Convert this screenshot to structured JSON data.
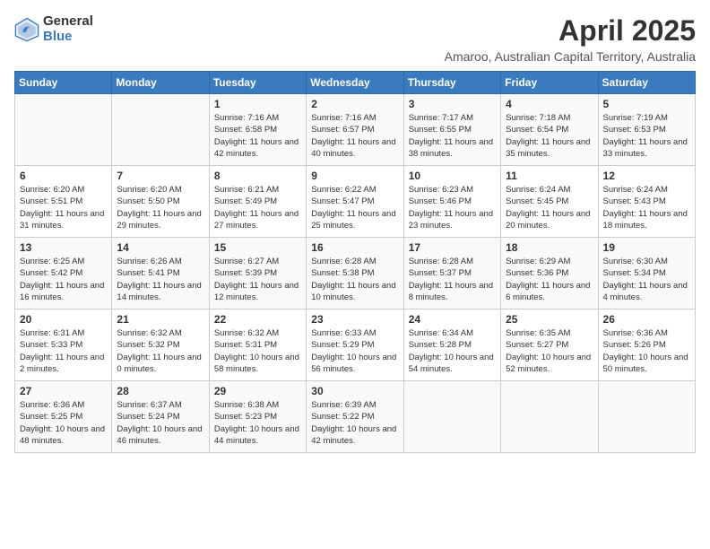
{
  "logo": {
    "general": "General",
    "blue": "Blue"
  },
  "title": "April 2025",
  "subtitle": "Amaroo, Australian Capital Territory, Australia",
  "days_of_week": [
    "Sunday",
    "Monday",
    "Tuesday",
    "Wednesday",
    "Thursday",
    "Friday",
    "Saturday"
  ],
  "weeks": [
    [
      {
        "day": "",
        "info": ""
      },
      {
        "day": "",
        "info": ""
      },
      {
        "day": "1",
        "sunrise": "Sunrise: 7:16 AM",
        "sunset": "Sunset: 6:58 PM",
        "daylight": "Daylight: 11 hours and 42 minutes."
      },
      {
        "day": "2",
        "sunrise": "Sunrise: 7:16 AM",
        "sunset": "Sunset: 6:57 PM",
        "daylight": "Daylight: 11 hours and 40 minutes."
      },
      {
        "day": "3",
        "sunrise": "Sunrise: 7:17 AM",
        "sunset": "Sunset: 6:55 PM",
        "daylight": "Daylight: 11 hours and 38 minutes."
      },
      {
        "day": "4",
        "sunrise": "Sunrise: 7:18 AM",
        "sunset": "Sunset: 6:54 PM",
        "daylight": "Daylight: 11 hours and 35 minutes."
      },
      {
        "day": "5",
        "sunrise": "Sunrise: 7:19 AM",
        "sunset": "Sunset: 6:53 PM",
        "daylight": "Daylight: 11 hours and 33 minutes."
      }
    ],
    [
      {
        "day": "6",
        "sunrise": "Sunrise: 6:20 AM",
        "sunset": "Sunset: 5:51 PM",
        "daylight": "Daylight: 11 hours and 31 minutes."
      },
      {
        "day": "7",
        "sunrise": "Sunrise: 6:20 AM",
        "sunset": "Sunset: 5:50 PM",
        "daylight": "Daylight: 11 hours and 29 minutes."
      },
      {
        "day": "8",
        "sunrise": "Sunrise: 6:21 AM",
        "sunset": "Sunset: 5:49 PM",
        "daylight": "Daylight: 11 hours and 27 minutes."
      },
      {
        "day": "9",
        "sunrise": "Sunrise: 6:22 AM",
        "sunset": "Sunset: 5:47 PM",
        "daylight": "Daylight: 11 hours and 25 minutes."
      },
      {
        "day": "10",
        "sunrise": "Sunrise: 6:23 AM",
        "sunset": "Sunset: 5:46 PM",
        "daylight": "Daylight: 11 hours and 23 minutes."
      },
      {
        "day": "11",
        "sunrise": "Sunrise: 6:24 AM",
        "sunset": "Sunset: 5:45 PM",
        "daylight": "Daylight: 11 hours and 20 minutes."
      },
      {
        "day": "12",
        "sunrise": "Sunrise: 6:24 AM",
        "sunset": "Sunset: 5:43 PM",
        "daylight": "Daylight: 11 hours and 18 minutes."
      }
    ],
    [
      {
        "day": "13",
        "sunrise": "Sunrise: 6:25 AM",
        "sunset": "Sunset: 5:42 PM",
        "daylight": "Daylight: 11 hours and 16 minutes."
      },
      {
        "day": "14",
        "sunrise": "Sunrise: 6:26 AM",
        "sunset": "Sunset: 5:41 PM",
        "daylight": "Daylight: 11 hours and 14 minutes."
      },
      {
        "day": "15",
        "sunrise": "Sunrise: 6:27 AM",
        "sunset": "Sunset: 5:39 PM",
        "daylight": "Daylight: 11 hours and 12 minutes."
      },
      {
        "day": "16",
        "sunrise": "Sunrise: 6:28 AM",
        "sunset": "Sunset: 5:38 PM",
        "daylight": "Daylight: 11 hours and 10 minutes."
      },
      {
        "day": "17",
        "sunrise": "Sunrise: 6:28 AM",
        "sunset": "Sunset: 5:37 PM",
        "daylight": "Daylight: 11 hours and 8 minutes."
      },
      {
        "day": "18",
        "sunrise": "Sunrise: 6:29 AM",
        "sunset": "Sunset: 5:36 PM",
        "daylight": "Daylight: 11 hours and 6 minutes."
      },
      {
        "day": "19",
        "sunrise": "Sunrise: 6:30 AM",
        "sunset": "Sunset: 5:34 PM",
        "daylight": "Daylight: 11 hours and 4 minutes."
      }
    ],
    [
      {
        "day": "20",
        "sunrise": "Sunrise: 6:31 AM",
        "sunset": "Sunset: 5:33 PM",
        "daylight": "Daylight: 11 hours and 2 minutes."
      },
      {
        "day": "21",
        "sunrise": "Sunrise: 6:32 AM",
        "sunset": "Sunset: 5:32 PM",
        "daylight": "Daylight: 11 hours and 0 minutes."
      },
      {
        "day": "22",
        "sunrise": "Sunrise: 6:32 AM",
        "sunset": "Sunset: 5:31 PM",
        "daylight": "Daylight: 10 hours and 58 minutes."
      },
      {
        "day": "23",
        "sunrise": "Sunrise: 6:33 AM",
        "sunset": "Sunset: 5:29 PM",
        "daylight": "Daylight: 10 hours and 56 minutes."
      },
      {
        "day": "24",
        "sunrise": "Sunrise: 6:34 AM",
        "sunset": "Sunset: 5:28 PM",
        "daylight": "Daylight: 10 hours and 54 minutes."
      },
      {
        "day": "25",
        "sunrise": "Sunrise: 6:35 AM",
        "sunset": "Sunset: 5:27 PM",
        "daylight": "Daylight: 10 hours and 52 minutes."
      },
      {
        "day": "26",
        "sunrise": "Sunrise: 6:36 AM",
        "sunset": "Sunset: 5:26 PM",
        "daylight": "Daylight: 10 hours and 50 minutes."
      }
    ],
    [
      {
        "day": "27",
        "sunrise": "Sunrise: 6:36 AM",
        "sunset": "Sunset: 5:25 PM",
        "daylight": "Daylight: 10 hours and 48 minutes."
      },
      {
        "day": "28",
        "sunrise": "Sunrise: 6:37 AM",
        "sunset": "Sunset: 5:24 PM",
        "daylight": "Daylight: 10 hours and 46 minutes."
      },
      {
        "day": "29",
        "sunrise": "Sunrise: 6:38 AM",
        "sunset": "Sunset: 5:23 PM",
        "daylight": "Daylight: 10 hours and 44 minutes."
      },
      {
        "day": "30",
        "sunrise": "Sunrise: 6:39 AM",
        "sunset": "Sunset: 5:22 PM",
        "daylight": "Daylight: 10 hours and 42 minutes."
      },
      {
        "day": "",
        "info": ""
      },
      {
        "day": "",
        "info": ""
      },
      {
        "day": "",
        "info": ""
      }
    ]
  ]
}
